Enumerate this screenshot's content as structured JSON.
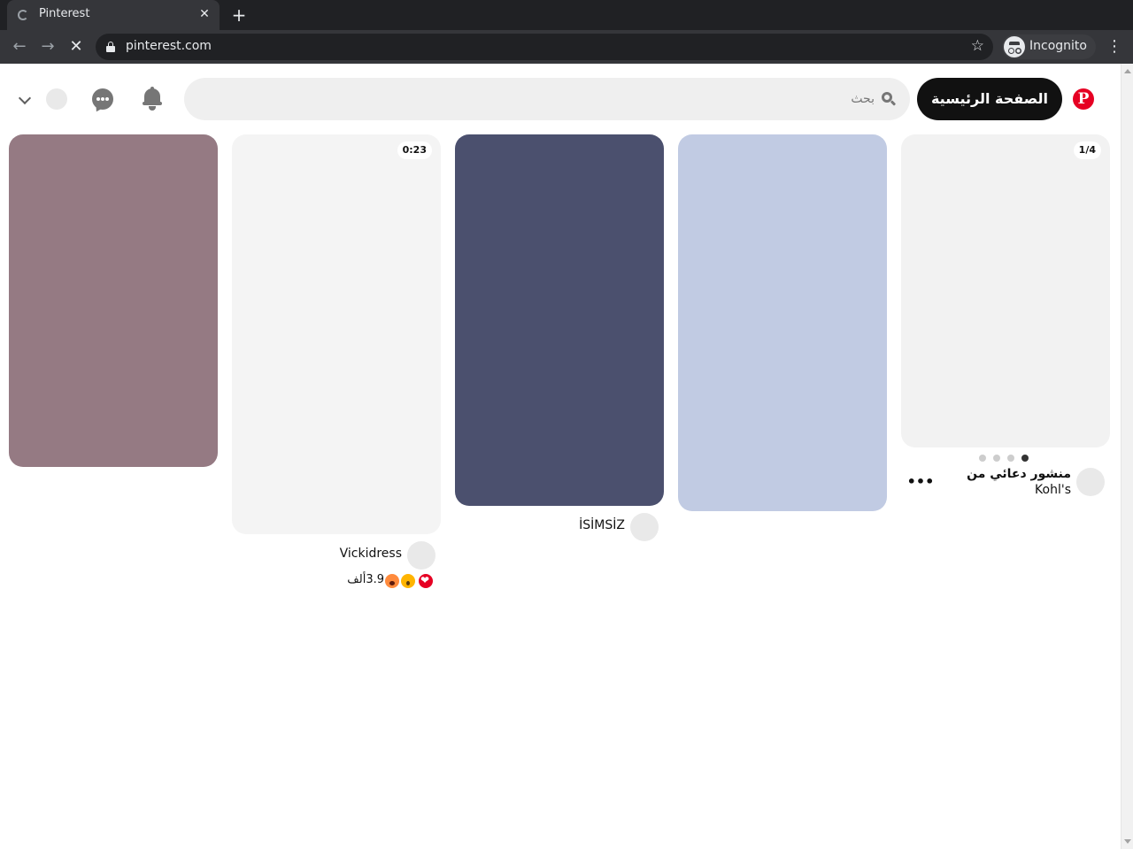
{
  "browser": {
    "tab_title": "Pinterest",
    "tab_close": "✕",
    "new_tab": "+",
    "url": "pinterest.com",
    "incognito_label": "Incognito"
  },
  "header": {
    "logo_glyph": "P",
    "home_label": "الصفحة الرئيسية",
    "search_placeholder": "بحث"
  },
  "pins": [
    {
      "type": "promoted",
      "badge": "1/4",
      "title": "منشور دعائي من",
      "subtitle": "Kohl's",
      "more": "•••",
      "image_color": "#f2f2f2",
      "carousel_total": 4,
      "carousel_active": 1
    },
    {
      "type": "image",
      "image_color": "#c1cbe3"
    },
    {
      "type": "image",
      "image_color": "#4b506e",
      "user": "İSİMSİZ"
    },
    {
      "type": "video",
      "badge": "0:23",
      "user": "Vickidress",
      "reactions_count": "3.9ألف",
      "image_color": "#f4f4f4"
    },
    {
      "type": "image",
      "image_color": "#957a83"
    }
  ],
  "colors": {
    "pinterest_red": "#e60023",
    "home_button_bg": "#111111",
    "search_bg": "#efefef"
  }
}
